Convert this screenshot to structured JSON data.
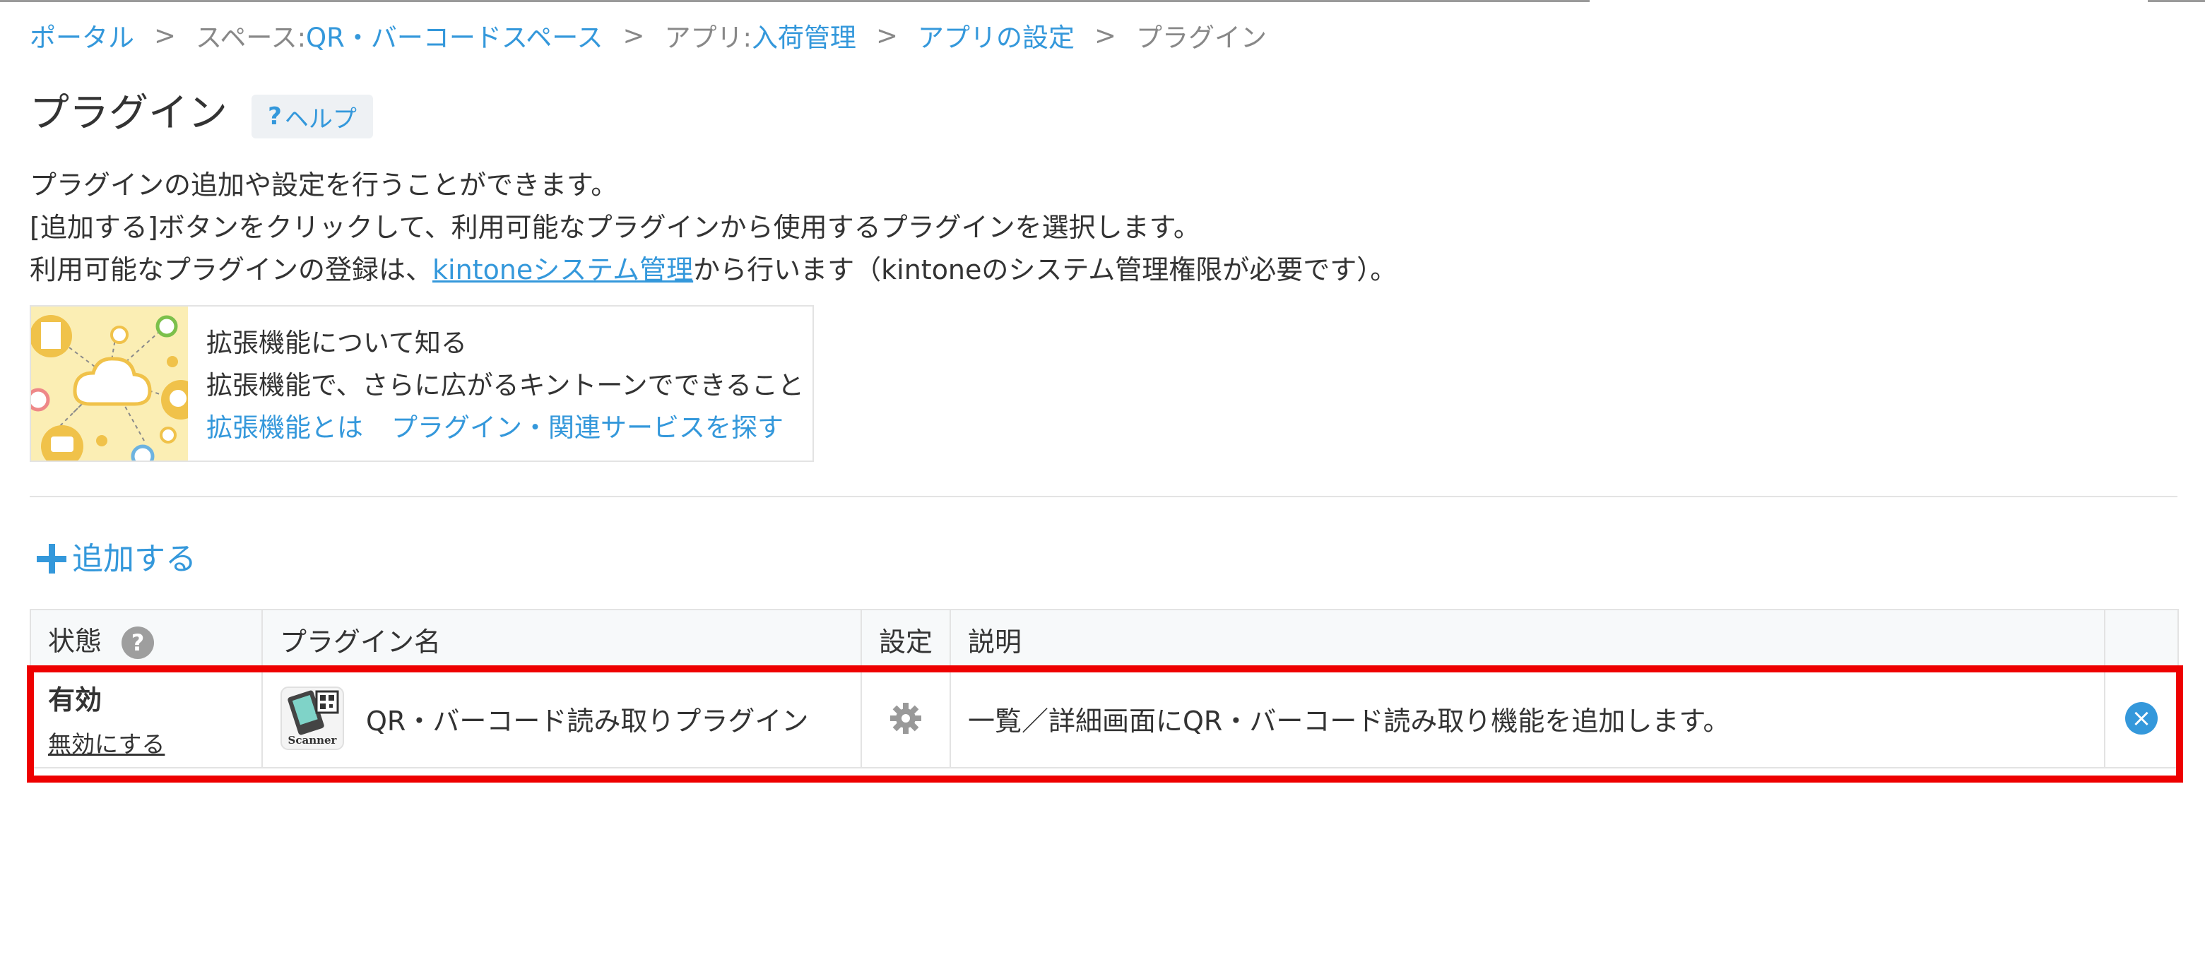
{
  "breadcrumb": {
    "portal": "ポータル",
    "space_prefix": "スペース: ",
    "space_name": "QR・バーコードスペース",
    "app_prefix": "アプリ: ",
    "app_name": "入荷管理",
    "app_settings": "アプリの設定",
    "current": "プラグイン",
    "separator": ">"
  },
  "header": {
    "title": "プラグイン",
    "help_mark": "?",
    "help_label": "ヘルプ"
  },
  "description": {
    "line1": "プラグインの追加や設定を行うことができます。",
    "line2": "[追加する]ボタンをクリックして、利用可能なプラグインから使用するプラグインを選択します。",
    "line3_before": "利用可能なプラグインの登録は、",
    "line3_link": "kintoneシステム管理",
    "line3_after": "から行います（kintoneのシステム管理権限が必要です）。"
  },
  "info_card": {
    "title": "拡張機能について知る",
    "subtitle": "拡張機能で、さらに広がるキントーンでできること",
    "link1": "拡張機能とは",
    "link2": "プラグイン・関連サービスを探す"
  },
  "add_button": {
    "icon": "plus-icon",
    "label": "追加する"
  },
  "table": {
    "headers": {
      "status": "状態",
      "status_help": "?",
      "plugin_name": "プラグイン名",
      "settings": "設定",
      "description": "説明"
    },
    "rows": [
      {
        "status": "有効",
        "disable_link": "無効にする",
        "plugin_icon": "scanner-icon",
        "plugin_icon_caption": "Scanner",
        "plugin_name": "QR・バーコード読み取りプラグイン",
        "settings_icon": "gear-icon",
        "description": "一覧／詳細画面にQR・バーコード読み取り機能を追加します。",
        "remove_icon": "close-icon",
        "remove_glyph": "×"
      }
    ]
  },
  "colors": {
    "link": "#3498db",
    "highlight": "#ee0000",
    "text": "#333333",
    "muted": "#888888"
  }
}
